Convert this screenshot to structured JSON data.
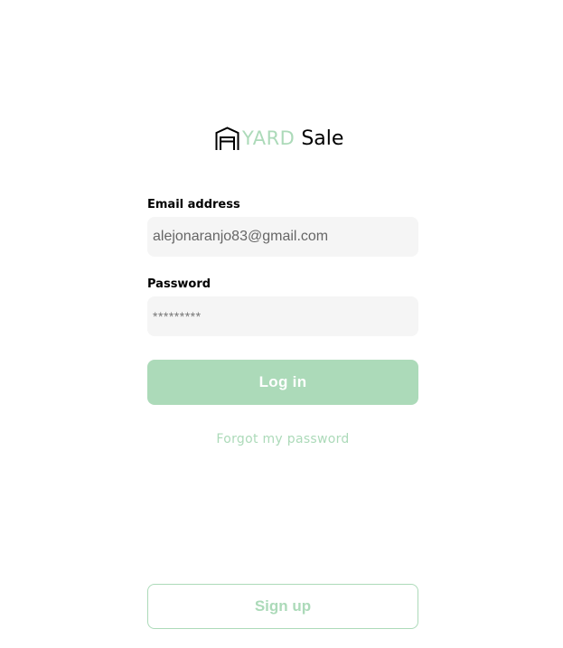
{
  "logo": {
    "icon": "garage-icon",
    "word_yard": "YARD",
    "word_sale": "Sale"
  },
  "form": {
    "email": {
      "label": "Email address",
      "value": "alejonaranjo83@gmail.com"
    },
    "password": {
      "label": "Password",
      "value": "*********"
    },
    "login_label": "Log in",
    "forgot_label": "Forgot my password"
  },
  "signup_label": "Sign up",
  "colors": {
    "accent": "#acdab9",
    "input_bg": "#f5f5f5",
    "text": "#000000"
  }
}
